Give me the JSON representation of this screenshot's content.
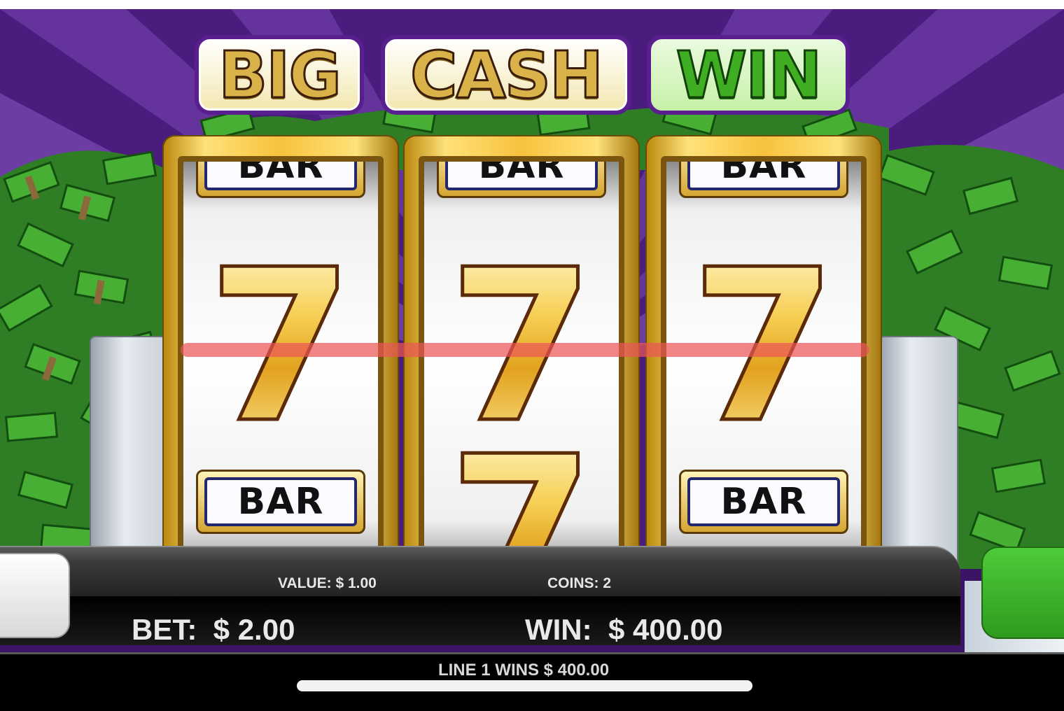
{
  "game": {
    "title_words": [
      "BIG",
      "CASH",
      "WIN"
    ],
    "reels": [
      {
        "top": "BAR",
        "middle": "7",
        "bottom": "BAR"
      },
      {
        "top": "BAR",
        "middle": "7",
        "bottom": "7"
      },
      {
        "top": "BAR",
        "middle": "7",
        "bottom": "BAR"
      }
    ]
  },
  "panel": {
    "value_label": "VALUE: $ 1.00",
    "coins_label": "COINS: 2",
    "bet_label": "BET:  $ 2.00",
    "win_label": "WIN:  $ 400.00"
  },
  "footer": {
    "message": "LINE 1 WINS $ 400.00"
  },
  "colors": {
    "background_purple": "#3b1466",
    "payline": "#ec5656",
    "spin_button": "#3fb52a"
  }
}
